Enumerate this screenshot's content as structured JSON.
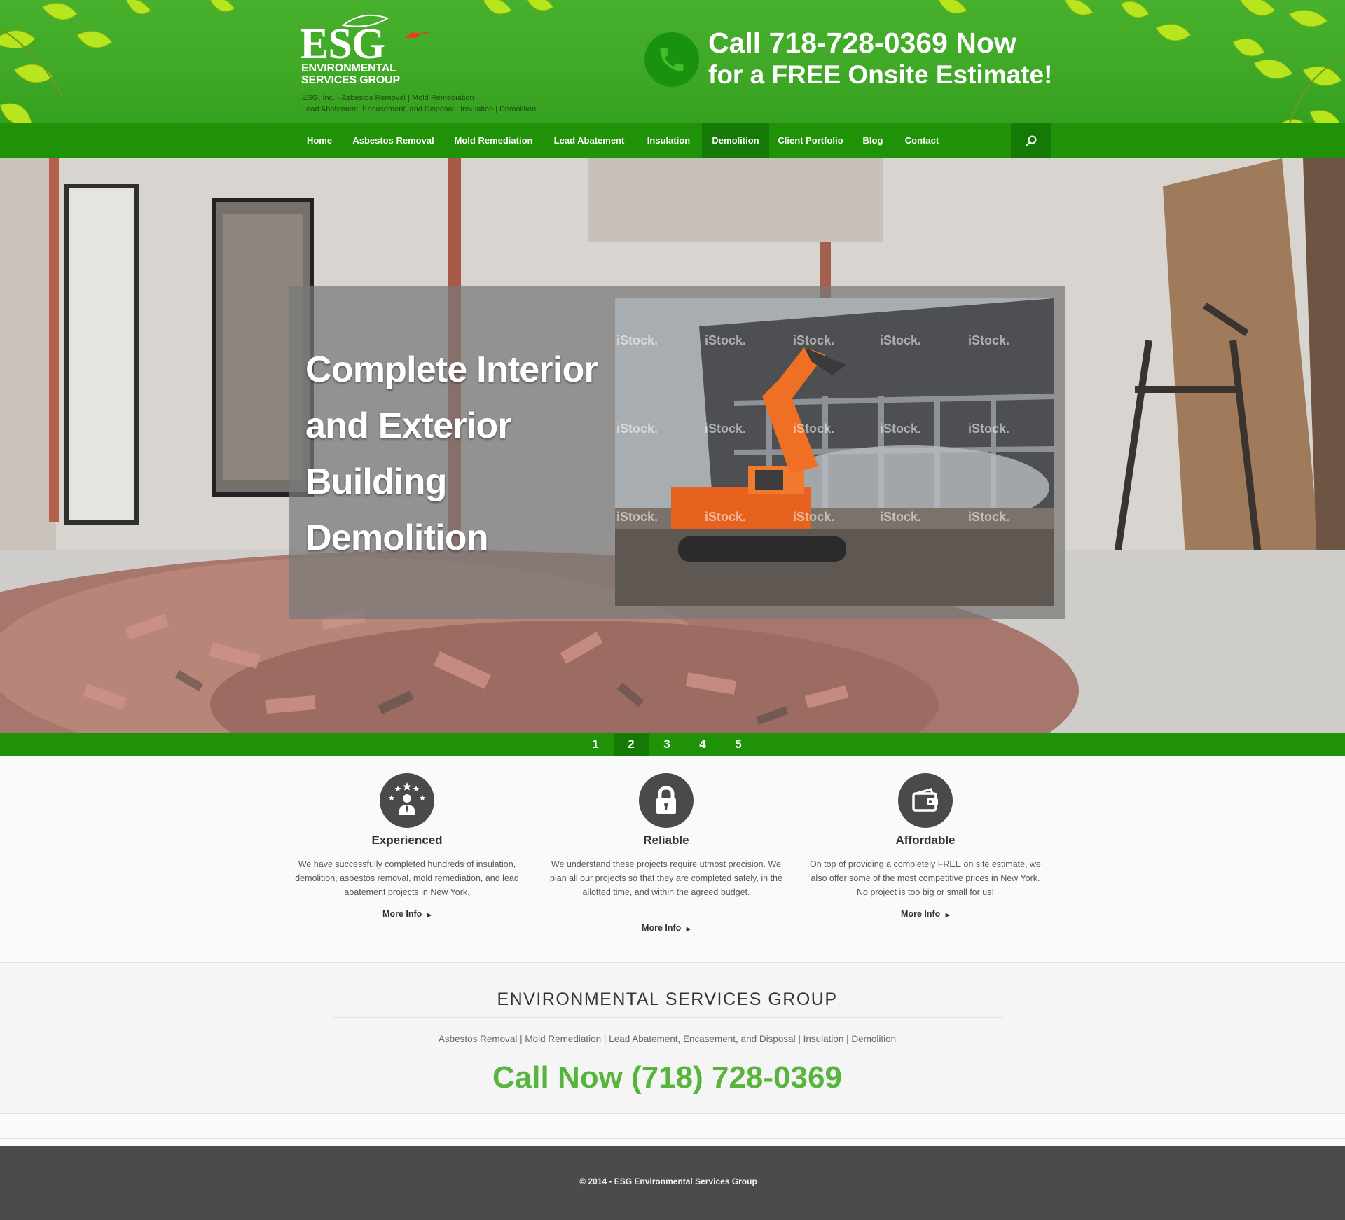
{
  "header": {
    "logo": {
      "mark": "ESG",
      "line1": "ENVIRONMENTAL",
      "line2": "SERVICES GROUP"
    },
    "tagline_line1": "ESG, Inc. - Asbestos Removal |  Mold Remediation",
    "tagline_line2": "Lead Abatement, Encasement, and Disposal | Insulation |  Demolition",
    "call_line1": "Call 718-728-0369 Now",
    "call_line2": "for a FREE Onsite Estimate!",
    "phone_icon": "phone-icon"
  },
  "nav": {
    "items": [
      {
        "label": "Home"
      },
      {
        "label": "Asbestos Removal"
      },
      {
        "label": "Mold Remediation"
      },
      {
        "label": "Lead Abatement"
      },
      {
        "label": "Insulation"
      },
      {
        "label": "Demolition",
        "active": true
      },
      {
        "label": "Client Portfolio"
      },
      {
        "label": "Blog"
      },
      {
        "label": "Contact"
      }
    ],
    "search_icon": "search-icon"
  },
  "hero": {
    "title": "Complete Interior and Exterior Building Demolition",
    "watermark": "iStock."
  },
  "pager": {
    "pages": [
      "1",
      "2",
      "3",
      "4",
      "5"
    ],
    "active_page": "2"
  },
  "features": [
    {
      "icon": "employee-stars-icon",
      "title": "Experienced",
      "text": "We have successfully completed hundreds of insulation, demolition, asbestos removal, mold remediation, and lead abatement projects in New York.",
      "more": "More Info"
    },
    {
      "icon": "padlock-icon",
      "title": "Reliable",
      "text": "We understand these projects require utmost precision. We plan all our projects so that they are completed safely, in the allotted time, and within the agreed budget.",
      "more": "More Info"
    },
    {
      "icon": "wallet-icon",
      "title": "Affordable",
      "text": "On top of providing a completely FREE on site estimate, we also offer some of the most competitive prices in New York. No project is too big or small for us!",
      "more": "More Info"
    }
  ],
  "info": {
    "title": "ENVIRONMENTAL SERVICES GROUP",
    "services": "Asbestos Removal | Mold Remediation | Lead Abatement, Encasement, and Disposal | Insulation | Demolition",
    "call": "Call Now (718) 728-0369"
  },
  "footer": {
    "copyright": "© 2014 - ESG Environmental Services Group"
  },
  "colors": {
    "header_green": "#47b02c",
    "nav_green": "#1f9207",
    "nav_active": "#157905",
    "call_green": "#57b43d",
    "footer_dark": "#4b4b4b"
  }
}
